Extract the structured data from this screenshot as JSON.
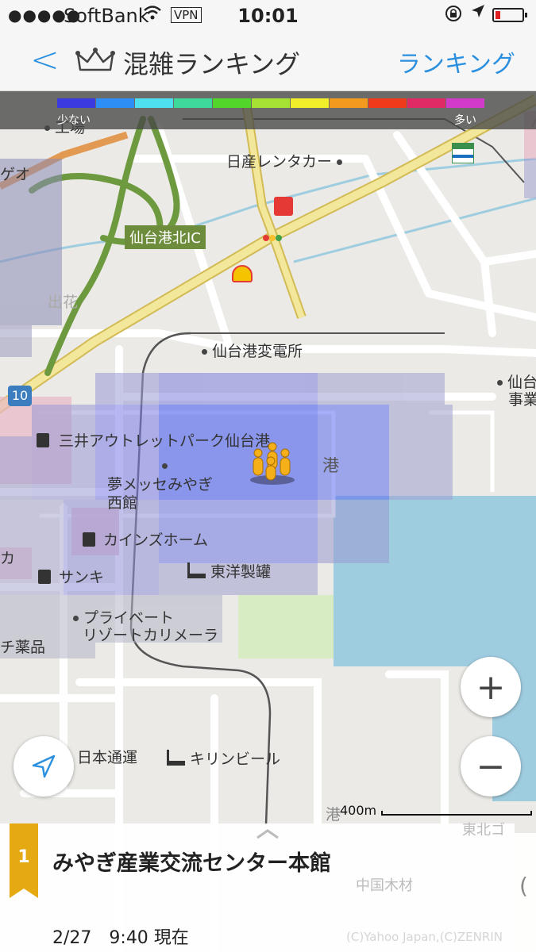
{
  "status_bar": {
    "signal": "●●●●●",
    "carrier": "SoftBank",
    "wifi": "wifi",
    "vpn": "VPN",
    "time": "10:01",
    "icons": [
      "orientation-lock-icon",
      "location-arrow-icon",
      "battery-icon"
    ],
    "battery_level": 0.15
  },
  "navbar": {
    "back": "<",
    "title": "混雑ランキング",
    "ranking_link": "ランキング"
  },
  "legend": {
    "low": "少ない",
    "high": "多い",
    "colors": [
      "#3a3ae0",
      "#2d8ef5",
      "#4fe0f0",
      "#3ed89a",
      "#53d62a",
      "#a6e233",
      "#f1ee2a",
      "#f39a1e",
      "#ef3a1c",
      "#e02a66",
      "#d23ac9"
    ]
  },
  "map": {
    "labels": {
      "factory_top": "工場",
      "geo": "ゲオ",
      "nissan_rent": "日産レンタカー",
      "ic": "仙台港北IC",
      "dehana": "出花",
      "substation": "仙台港変電所",
      "sendai_right": "仙台",
      "jigyo": "事業",
      "route": "10",
      "outlet": "三井アウトレットパーク仙台港",
      "messe": "夢メッセみやぎ",
      "messe2": "西館",
      "port": "港",
      "cainz": "カインズホーム",
      "ka": "カ",
      "sanki": "サンキ",
      "toyo": "東洋製罐",
      "private_resort": "プライベート",
      "private_resort2": "リゾートカリメーラ",
      "drug": "チ薬品",
      "nittsu": "日本通運",
      "kirin": "キリンビール",
      "port2": "港",
      "tohoku": "東北ゴ",
      "chugoku": "中国木材"
    },
    "scale": "400m",
    "copyright": "(C)Yahoo Japan,(C)ZENRIN"
  },
  "controls": {
    "zoom_in": "+",
    "zoom_out": "−"
  },
  "panel": {
    "rank": "1",
    "place": "みやぎ産業交流センター本館",
    "time": "2/27　9:40 現在"
  },
  "side_tab": "("
}
